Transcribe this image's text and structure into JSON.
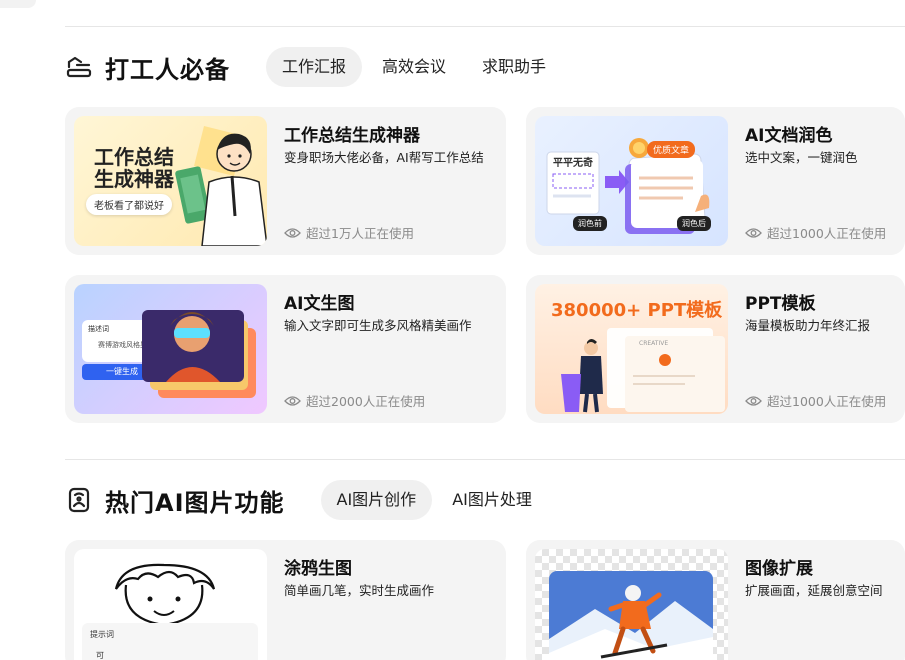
{
  "section1": {
    "title": "打工人必备",
    "icon": "tools-icon",
    "tabs": [
      {
        "label": "工作汇报",
        "active": true
      },
      {
        "label": "高效会议",
        "active": false
      },
      {
        "label": "求职助手",
        "active": false
      }
    ],
    "cards": [
      {
        "title": "工作总结生成神器",
        "desc": "变身职场大佬必备，AI帮写工作总结",
        "usage": "超过1万人正在使用",
        "thumb": {
          "headline_line1": "工作总结",
          "headline_line2": "生成神器",
          "bubble": "老板看了都说好",
          "book": "工作总结"
        }
      },
      {
        "title": "AI文档润色",
        "desc": "选中文案，一键润色",
        "usage": "超过1000人正在使用",
        "thumb": {
          "left_label": "平平无奇",
          "right_label": "优质文章",
          "before_tag": "润色前",
          "after_tag": "润色后"
        }
      },
      {
        "title": "AI文生图",
        "desc": "输入文字即可生成多风格精美画作",
        "usage": "超过2000人正在使用",
        "thumb": {
          "prompt_label": "描述词",
          "prompt_text": "赛博游戏风格男孩",
          "button": "一键生成"
        }
      },
      {
        "title": "PPT模板",
        "desc": "海量模板助力年终汇报",
        "usage": "超过1000人正在使用",
        "thumb": {
          "headline": "380000+ PPT模板",
          "slide_text": "CREATIVE"
        }
      }
    ]
  },
  "section2": {
    "title": "热门AI图片功能",
    "icon": "image-ai-icon",
    "tabs": [
      {
        "label": "AI图片创作",
        "active": true
      },
      {
        "label": "AI图片处理",
        "active": false
      }
    ],
    "cards": [
      {
        "title": "涂鸦生图",
        "desc": "简单画几笔，实时生成画作",
        "thumb": {
          "prompt_label": "提示词",
          "prompt_text": "可"
        }
      },
      {
        "title": "图像扩展",
        "desc": "扩展画面，延展创意空间"
      }
    ]
  },
  "colors": {
    "card_bg": "#f4f4f4",
    "tab_active_bg": "#f0f0f0",
    "usage_text": "#8a8a8a",
    "accent_orange": "#f26b1d",
    "accent_blue": "#2f62f0"
  }
}
